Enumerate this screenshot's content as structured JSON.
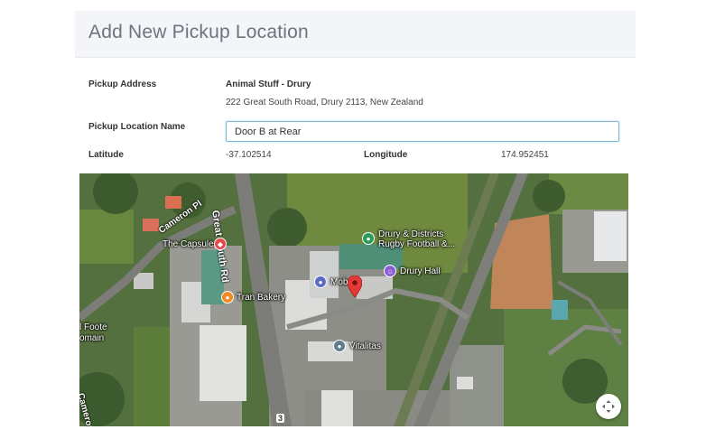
{
  "panel": {
    "title": "Add New Pickup Location"
  },
  "form": {
    "pickup_address_label": "Pickup Address",
    "address_name": "Animal Stuff - Drury",
    "address_line": "222 Great South Road, Drury 2113, New Zealand",
    "location_name_label": "Pickup Location Name",
    "location_name_value": "Door B at Rear",
    "latitude_label": "Latitude",
    "latitude_value": "-37.102514",
    "longitude_label": "Longitude",
    "longitude_value": "174.952451"
  },
  "map": {
    "roads": {
      "great_south_rd": "Great South Rd",
      "cameron_pl": "Cameron Pl",
      "cameron_bottom": "Cameron",
      "number_3": "3"
    },
    "places": {
      "capsule": "The Capsule",
      "bakery": "Tran Bakery",
      "rugby_line1": "Drury & Districts",
      "rugby_line2": "Rugby Football &...",
      "drury_hall": "Drury Hall",
      "mob": "Mob",
      "vitalitas": "Vitalitas",
      "foote_line1": "l Foote",
      "foote_line2": "omain"
    },
    "colors": {
      "pin": "#e53935",
      "poi_green": "#2e9a5a",
      "poi_purple": "#8e5bd6",
      "poi_orange": "#f08a24",
      "poi_red": "#e5484d"
    }
  }
}
